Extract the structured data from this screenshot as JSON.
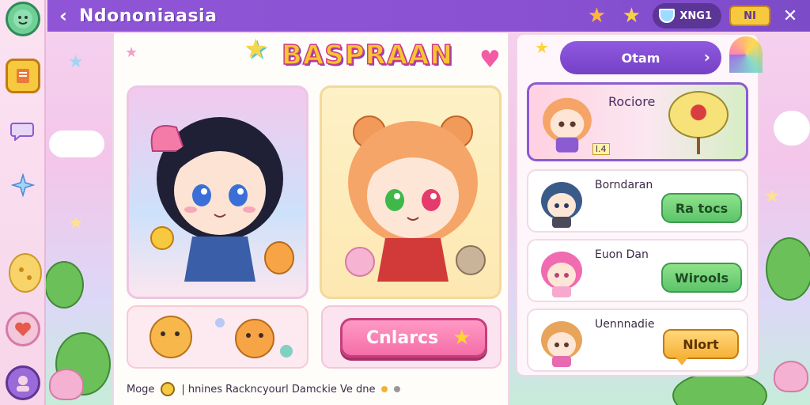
{
  "header": {
    "title": "Ndononiaasia",
    "currency_label": "XNG1",
    "yellow_pill_label": "NI"
  },
  "main": {
    "logo": "BASPRAAN",
    "action_button_label": "Cnlarcs",
    "status_line": {
      "prefix": "Moge",
      "text": "| hnines Rackncyourl Damckie Ve dne"
    }
  },
  "right_panel": {
    "top_button_label": "Otam",
    "feature": {
      "title": "Rociore",
      "badge": "l.4"
    },
    "rows": [
      {
        "name": "Borndaran",
        "button_label": "Ra tocs",
        "button_style": "green"
      },
      {
        "name": "Euon Dan",
        "button_label": "Wirools",
        "button_style": "green"
      },
      {
        "name": "Uennnadie",
        "button_label": "Nlort",
        "button_style": "orange"
      }
    ]
  },
  "colors": {
    "top_bar": "#8f55d6",
    "accent_pink": "#f46ea7",
    "accent_green": "#5cc46a",
    "accent_orange": "#f6b238",
    "logo_yellow": "#f8c530"
  },
  "icons": {
    "left_rail": [
      "face-icon",
      "notebook-icon",
      "chat-bubble-icon",
      "sparkle-icon",
      "cookie-icon",
      "ribbon-heart-icon",
      "avatar-icon"
    ],
    "top": [
      "star-icon",
      "star-icon",
      "cup-icon",
      "close-icon"
    ]
  }
}
